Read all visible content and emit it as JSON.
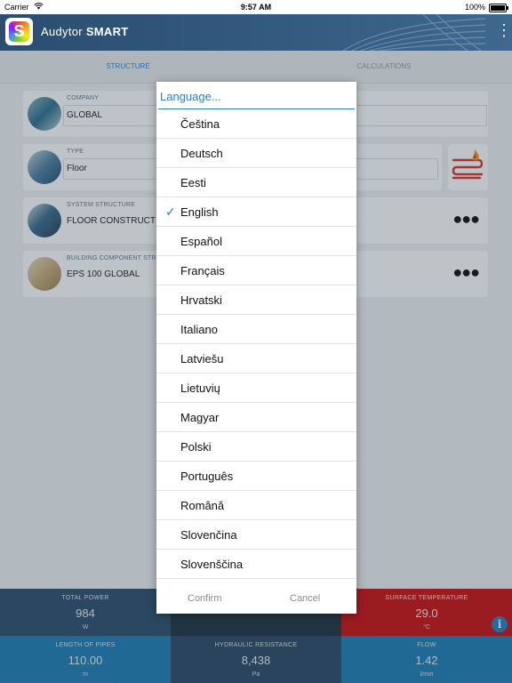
{
  "status_bar": {
    "carrier": "Carrier",
    "time": "9:57 AM",
    "battery": "100%"
  },
  "app": {
    "title_prefix": "Audytor",
    "title_suffix": "SMART"
  },
  "tabs": [
    {
      "label": "STRUCTURE"
    },
    {
      "label": "CALCULATIONS"
    }
  ],
  "cards": {
    "company": {
      "label": "COMPANY",
      "value": "GLOBAL"
    },
    "type": {
      "label": "TYPE",
      "value": "Floor"
    },
    "system_structure": {
      "label": "SYSTEM STRUCTURE",
      "value": "FLOOR CONSTRUCT"
    },
    "building_component": {
      "label": "BUILDING COMPONENT STR",
      "value": "EPS 100 GLOBAL"
    }
  },
  "stats": [
    {
      "label": "TOTAL POWER",
      "value": "984",
      "unit": "W",
      "color": "#2d4e6e"
    },
    {
      "label": "",
      "value": "",
      "unit": "",
      "color": "#1f3344"
    },
    {
      "label": "SURFACE TEMPERATURE",
      "value": "29.0",
      "unit": "°C",
      "color": "#cc1111"
    },
    {
      "label": "LENGTH OF PIPES",
      "value": "110.00",
      "unit": "m",
      "color": "#1f7fb8"
    },
    {
      "label": "HYDRAULIC RESISTANCE",
      "value": "8,438",
      "unit": "Pa",
      "color": "#2a4a66"
    },
    {
      "label": "FLOW",
      "value": "1.42",
      "unit": "l/min",
      "color": "#1f7fb8"
    }
  ],
  "dialog": {
    "title": "Language...",
    "selected": "English",
    "languages": [
      "Čeština",
      "Deutsch",
      "Eesti",
      "English",
      "Español",
      "Français",
      "Hrvatski",
      "Italiano",
      "Latviešu",
      "Lietuvių",
      "Magyar",
      "Polski",
      "Português",
      "Română",
      "Slovenčina",
      "Slovenščina"
    ],
    "confirm": "Confirm",
    "cancel": "Cancel",
    "accent_color": "#2d7fc4"
  }
}
